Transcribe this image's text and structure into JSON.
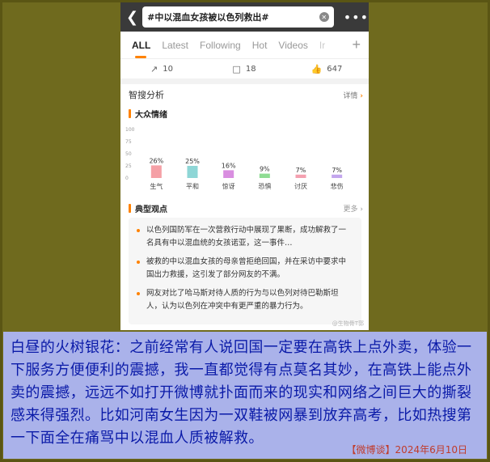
{
  "header": {
    "back_icon": "chevron-left-icon",
    "search_query": "#中以混血女孩被以色列救出#",
    "clear_icon": "clear-circle-icon",
    "more_icon": "more-dots-icon"
  },
  "tabs": [
    "ALL",
    "Latest",
    "Following",
    "Hot",
    "Videos",
    "Ir"
  ],
  "tab_plus": "+",
  "actions": {
    "repost": "10",
    "comment": "18",
    "like": "647"
  },
  "smart_search": {
    "title": "智搜分析",
    "more": "详情"
  },
  "sentiment": {
    "title": "大众情绪"
  },
  "chart_data": {
    "type": "bar",
    "title": "大众情绪",
    "categories": [
      "生气",
      "平和",
      "惊讶",
      "恐惧",
      "讨厌",
      "悲伤"
    ],
    "values": [
      26,
      25,
      16,
      9,
      7,
      7
    ],
    "value_labels": [
      "26%",
      "25%",
      "16%",
      "9%",
      "7%",
      "7%"
    ],
    "yticks": [
      "100",
      "75",
      "50",
      "25",
      "0"
    ],
    "ylim": [
      0,
      100
    ],
    "colors": [
      "#f5a0a6",
      "#8ed6d6",
      "#d98ee0",
      "#8fdc93",
      "#f4a0b0",
      "#c3a6ee"
    ]
  },
  "opinions": {
    "title": "典型观点",
    "more": "更多",
    "items": [
      "以色列国防军在一次营救行动中展现了果断，成功解救了一名具有中以混血统的女孩诺亚，这一事件…",
      "被救的中以混血女孩的母亲曾拒绝回国，并在采访中要求中国出力救援，这引发了部分网友的不满。",
      "网友对比了哈马斯对待人质的行为与以色列对待巴勒斯坦人，认为以色列在冲突中有更严重的暴力行为。"
    ]
  },
  "watermark": "@生物骨T郭",
  "caption": {
    "text": "白昼的火树银花：之前经常有人说回国一定要在高铁上点外卖，体验一下服务方便便利的震撼，我一直都觉得有点莫名其妙，在高铁上能点外卖的震撼，远远不如打开微博就扑面而来的现实和网络之间巨大的撕裂感来得强烈。比如河南女生因为一双鞋被网暴到放弃高考，比如热搜第一下面全在痛骂中以混血人质被解救。",
    "source": "【微博谈】2024年6月10日"
  }
}
